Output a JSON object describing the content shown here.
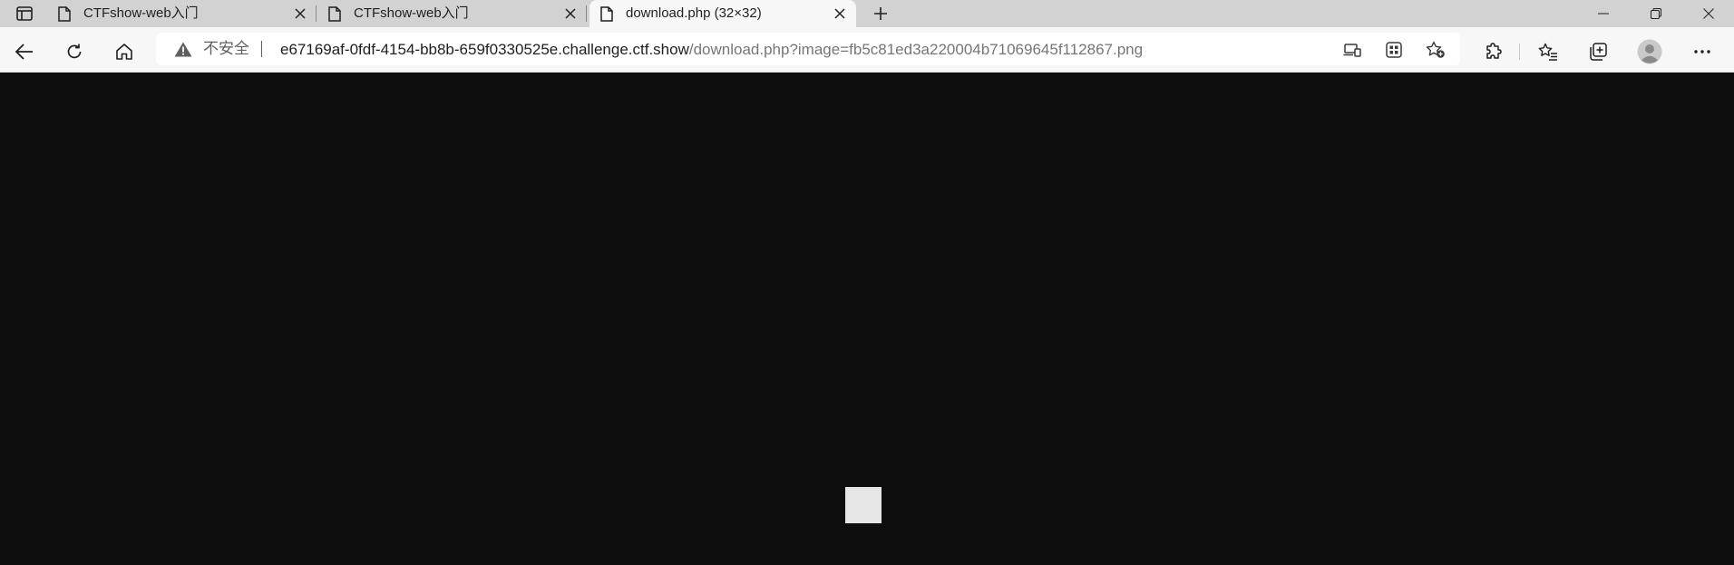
{
  "tabs": [
    {
      "label": "CTFshow-web入门",
      "favicon": "page-icon",
      "active": false
    },
    {
      "label": "CTFshow-web入门",
      "favicon": "page-icon",
      "active": false
    },
    {
      "label": "download.php (32×32)",
      "favicon": "page-icon",
      "active": true
    }
  ],
  "address_bar": {
    "security_label": "不安全",
    "url_host": "e67169af-0fdf-4154-bb8b-659f0330525e.challenge.ctf.show",
    "url_path": "/download.php?image=fb5c81ed3a220004b71069645f112867.png"
  },
  "colors": {
    "page_background": "#0e0e0e",
    "image_pixel": "#e6e6e6",
    "tab_strip": "#d2d2d2",
    "toolbar": "#f7f7f7"
  },
  "icons": [
    "tab-actions-icon",
    "page-icon",
    "close-icon",
    "plus-icon",
    "minimize-icon",
    "restore-icon",
    "window-close-icon",
    "back-arrow-icon",
    "refresh-icon",
    "home-icon",
    "warning-icon",
    "read-aloud-icon",
    "apps-icon",
    "add-favorite-icon",
    "extensions-icon",
    "favorites-icon",
    "collections-icon",
    "profile-icon",
    "more-icon"
  ]
}
